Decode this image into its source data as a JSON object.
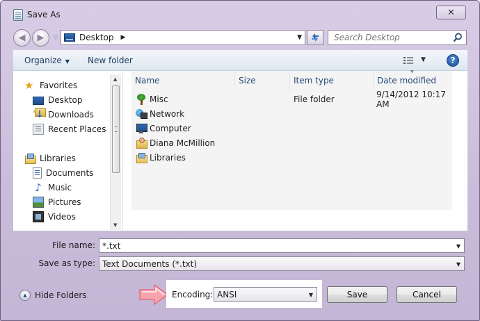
{
  "window": {
    "title": "Save As",
    "close_glyph": "✕"
  },
  "nav": {
    "address": "Desktop",
    "search_placeholder": "Search Desktop"
  },
  "toolbar": {
    "organize_label": "Organize",
    "new_folder_label": "New folder",
    "help_glyph": "?"
  },
  "sidebar": {
    "favorites": [
      {
        "label": "Favorites",
        "icon": "star-icon"
      },
      {
        "label": "Desktop",
        "icon": "desktop-icon"
      },
      {
        "label": "Downloads",
        "icon": "downloads-icon"
      },
      {
        "label": "Recent Places",
        "icon": "recent-places-icon"
      }
    ],
    "libraries": [
      {
        "label": "Libraries",
        "icon": "libraries-icon"
      },
      {
        "label": "Documents",
        "icon": "documents-icon"
      },
      {
        "label": "Music",
        "icon": "music-icon"
      },
      {
        "label": "Pictures",
        "icon": "pictures-icon"
      },
      {
        "label": "Videos",
        "icon": "videos-icon"
      }
    ]
  },
  "filelist": {
    "columns": {
      "name": "Name",
      "size": "Size",
      "type": "Item type",
      "date": "Date modified"
    },
    "rows": [
      {
        "name": "Misc",
        "type": "File folder",
        "date": "9/14/2012 10:17 AM",
        "icon": "tree-folder-icon"
      },
      {
        "name": "Network",
        "type": "",
        "date": "",
        "icon": "network-icon"
      },
      {
        "name": "Computer",
        "type": "",
        "date": "",
        "icon": "computer-icon"
      },
      {
        "name": "Diana McMillion",
        "type": "",
        "date": "",
        "icon": "user-folder-icon"
      },
      {
        "name": "Libraries",
        "type": "",
        "date": "",
        "icon": "libraries-icon"
      }
    ]
  },
  "form": {
    "file_name_label": "File name:",
    "file_name_value": "*.txt",
    "save_as_type_label": "Save as type:",
    "save_as_type_value": "Text Documents (*.txt)",
    "encoding_label": "Encoding:",
    "encoding_value": "ANSI"
  },
  "footer": {
    "hide_folders_label": "Hide Folders",
    "save_label": "Save",
    "cancel_label": "Cancel"
  },
  "colors": {
    "window_frame": "#c9bcd9",
    "toolbar": "#dde6f0",
    "highlight_arrow": "#f6a3ad"
  }
}
